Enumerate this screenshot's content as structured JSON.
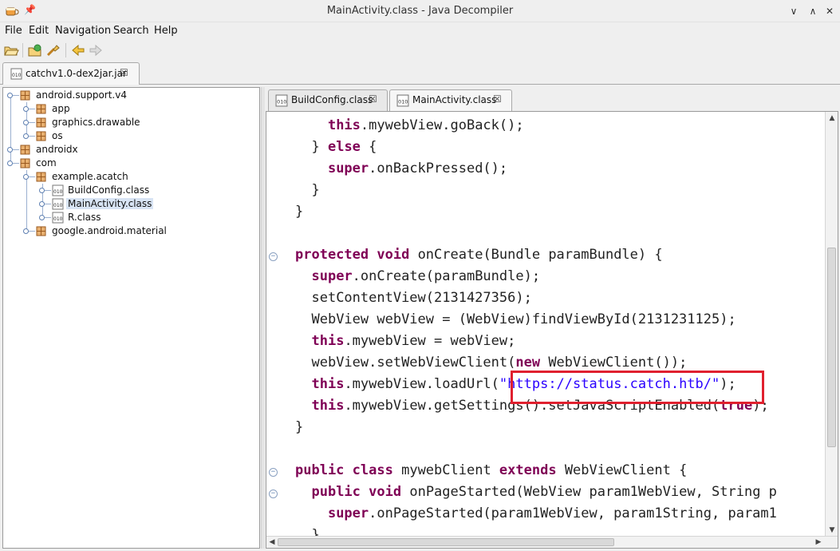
{
  "window": {
    "title": "MainActivity.class - Java Decompiler",
    "minimize_glyph": "∨",
    "maximize_glyph": "∧",
    "close_glyph": "✕",
    "pin_glyph": "📌"
  },
  "menu": {
    "items": [
      "File",
      "Edit",
      "Navigation",
      "Search",
      "Help"
    ]
  },
  "toolbar": {
    "icons": [
      "open-folder-icon",
      "open-type-icon",
      "search-icon",
      "back-icon",
      "forward-icon"
    ]
  },
  "file_tab": {
    "label": "catchv1.0-dex2jar.jar",
    "close": "☒"
  },
  "tree": {
    "nodes": [
      {
        "label": "android.support.v4",
        "kind": "package"
      },
      {
        "label": "app",
        "kind": "package"
      },
      {
        "label": "graphics.drawable",
        "kind": "package"
      },
      {
        "label": "os",
        "kind": "package"
      },
      {
        "label": "androidx",
        "kind": "package"
      },
      {
        "label": "com",
        "kind": "package"
      },
      {
        "label": "example.acatch",
        "kind": "package"
      },
      {
        "label": "BuildConfig.class",
        "kind": "class"
      },
      {
        "label": "MainActivity.class",
        "kind": "class",
        "selected": true
      },
      {
        "label": "R.class",
        "kind": "class"
      },
      {
        "label": "google.android.material",
        "kind": "package"
      }
    ]
  },
  "editor_tabs": [
    {
      "label": "BuildConfig.class",
      "close": "☒",
      "active": false
    },
    {
      "label": "MainActivity.class",
      "close": "☒",
      "active": true
    }
  ],
  "code_lines": [
    {
      "indent": "    ",
      "parts": [
        [
          "kw",
          "this"
        ],
        [
          "t",
          ".mywebView.goBack();"
        ]
      ]
    },
    {
      "indent": "  ",
      "parts": [
        [
          "t",
          "} "
        ],
        [
          "kw",
          "else"
        ],
        [
          "t",
          " {"
        ]
      ]
    },
    {
      "indent": "    ",
      "parts": [
        [
          "kw",
          "super"
        ],
        [
          "t",
          ".onBackPressed();"
        ]
      ]
    },
    {
      "indent": "  ",
      "parts": [
        [
          "t",
          "}"
        ]
      ]
    },
    {
      "indent": "",
      "parts": [
        [
          "t",
          "}"
        ]
      ]
    },
    {
      "indent": "",
      "parts": []
    },
    {
      "indent": "",
      "parts": [
        [
          "kw",
          "protected"
        ],
        [
          "t",
          " "
        ],
        [
          "kw",
          "void"
        ],
        [
          "t",
          " onCreate(Bundle paramBundle) {"
        ]
      ]
    },
    {
      "indent": "  ",
      "parts": [
        [
          "kw",
          "super"
        ],
        [
          "t",
          ".onCreate(paramBundle);"
        ]
      ]
    },
    {
      "indent": "  ",
      "parts": [
        [
          "t",
          "setContentView(2131427356);"
        ]
      ]
    },
    {
      "indent": "  ",
      "parts": [
        [
          "t",
          "WebView webView = (WebView)findViewById(2131231125);"
        ]
      ]
    },
    {
      "indent": "  ",
      "parts": [
        [
          "kw",
          "this"
        ],
        [
          "t",
          ".mywebView = webView;"
        ]
      ]
    },
    {
      "indent": "  ",
      "parts": [
        [
          "t",
          "webView.setWebViewClient("
        ],
        [
          "kw",
          "new"
        ],
        [
          "t",
          " WebViewClient());"
        ]
      ]
    },
    {
      "indent": "  ",
      "parts": [
        [
          "kw",
          "this"
        ],
        [
          "t",
          ".mywebView.loadUrl("
        ],
        [
          "str",
          "\"https://status.catch.htb/\""
        ],
        [
          "t",
          ");"
        ]
      ]
    },
    {
      "indent": "  ",
      "parts": [
        [
          "kw",
          "this"
        ],
        [
          "t",
          ".mywebView.getSettings().setJavaScriptEnabled("
        ],
        [
          "kw",
          "true"
        ],
        [
          "t",
          ");"
        ]
      ]
    },
    {
      "indent": "",
      "parts": [
        [
          "t",
          "}"
        ]
      ]
    },
    {
      "indent": "",
      "parts": []
    },
    {
      "indent": "",
      "parts": [
        [
          "kw",
          "public"
        ],
        [
          "t",
          " "
        ],
        [
          "kw",
          "class"
        ],
        [
          "t",
          " mywebClient "
        ],
        [
          "kw",
          "extends"
        ],
        [
          "t",
          " WebViewClient {"
        ]
      ]
    },
    {
      "indent": "  ",
      "parts": [
        [
          "kw",
          "public"
        ],
        [
          "t",
          " "
        ],
        [
          "kw",
          "void"
        ],
        [
          "t",
          " onPageStarted(WebView param1WebView, String p"
        ]
      ]
    },
    {
      "indent": "    ",
      "parts": [
        [
          "kw",
          "super"
        ],
        [
          "t",
          ".onPageStarted(param1WebView, param1String, param1"
        ]
      ]
    },
    {
      "indent": "  ",
      "parts": [
        [
          "t",
          "}"
        ]
      ]
    }
  ],
  "colors": {
    "keyword": "#7f0055",
    "string": "#2a00ff",
    "highlight_box": "#e0202e"
  }
}
